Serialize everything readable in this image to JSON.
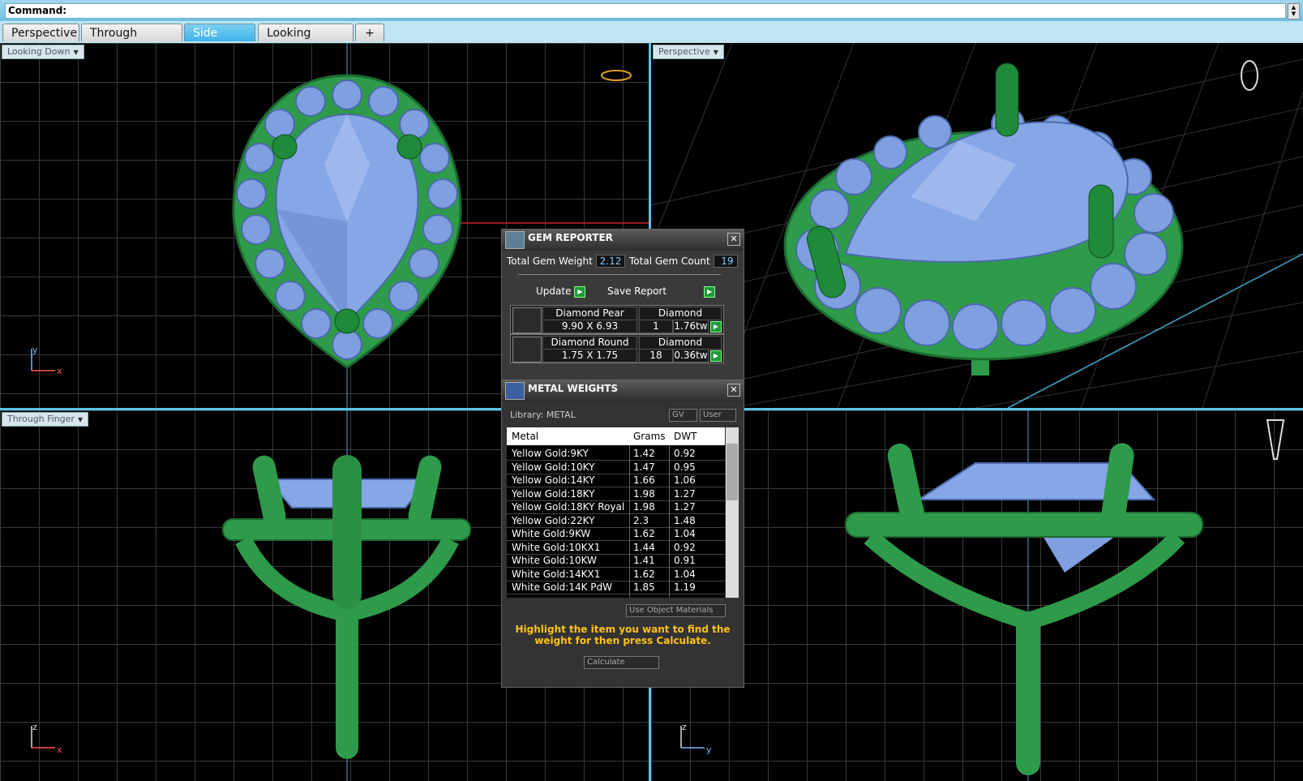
{
  "command": {
    "label": "Command:"
  },
  "tabs": [
    {
      "label": "Perspective"
    },
    {
      "label": "Through Finger"
    },
    {
      "label": "Side View"
    },
    {
      "label": "Looking Down"
    },
    {
      "label": "+"
    }
  ],
  "viewports": {
    "top_left": {
      "label": "Looking Down",
      "axis_y": "y",
      "axis_x": "x"
    },
    "top_right": {
      "label": "Perspective"
    },
    "bottom_left": {
      "label": "Through Finger",
      "axis_y": "z",
      "axis_x": "x"
    },
    "bottom_right": {
      "axis_y": "z",
      "axis_x": "y"
    }
  },
  "gem_reporter": {
    "title": "GEM REPORTER",
    "total_weight_label": "Total Gem Weight",
    "total_weight": "2.12",
    "total_count_label": "Total Gem Count",
    "total_count": "19",
    "update_label": "Update",
    "save_label": "Save Report",
    "gems": [
      {
        "name": "Diamond Pear",
        "size": "9.90 X 6.93",
        "material": "Diamond",
        "count": "1",
        "weight": "1.76tw"
      },
      {
        "name": "Diamond Round",
        "size": "1.75 X 1.75",
        "material": "Diamond",
        "count": "18",
        "weight": "0.36tw"
      }
    ]
  },
  "metal_weights": {
    "title": "METAL WEIGHTS",
    "library": "Library: METAL",
    "gv_label": "GV",
    "user_label": "User",
    "headers": {
      "metal": "Metal",
      "grams": "Grams",
      "dwt": "DWT"
    },
    "rows": [
      {
        "metal": "Yellow Gold:9KY",
        "grams": "1.42",
        "dwt": "0.92"
      },
      {
        "metal": "Yellow Gold:10KY",
        "grams": "1.47",
        "dwt": "0.95"
      },
      {
        "metal": "Yellow Gold:14KY",
        "grams": "1.66",
        "dwt": "1.06"
      },
      {
        "metal": "Yellow Gold:18KY",
        "grams": "1.98",
        "dwt": "1.27"
      },
      {
        "metal": "Yellow Gold:18KY Royal",
        "grams": "1.98",
        "dwt": "1.27"
      },
      {
        "metal": "Yellow Gold:22KY",
        "grams": "2.3",
        "dwt": "1.48"
      },
      {
        "metal": "White Gold:9KW",
        "grams": "1.62",
        "dwt": "1.04"
      },
      {
        "metal": "White Gold:10KX1",
        "grams": "1.44",
        "dwt": "0.92"
      },
      {
        "metal": "White Gold:10KW",
        "grams": "1.41",
        "dwt": "0.91"
      },
      {
        "metal": "White Gold:14KX1",
        "grams": "1.62",
        "dwt": "1.04"
      },
      {
        "metal": "White Gold:14K PdW",
        "grams": "1.85",
        "dwt": "1.19"
      }
    ],
    "use_object_materials": "Use Object Materials",
    "info": "Highlight the item you want to find the weight for then press Calculate.",
    "calculate": "Calculate"
  },
  "colors": {
    "metal_green": "#2e9b4a",
    "gem_blue": "#7f9fe0",
    "accent": "#5ac3e6",
    "info_text": "#ffc11a"
  }
}
